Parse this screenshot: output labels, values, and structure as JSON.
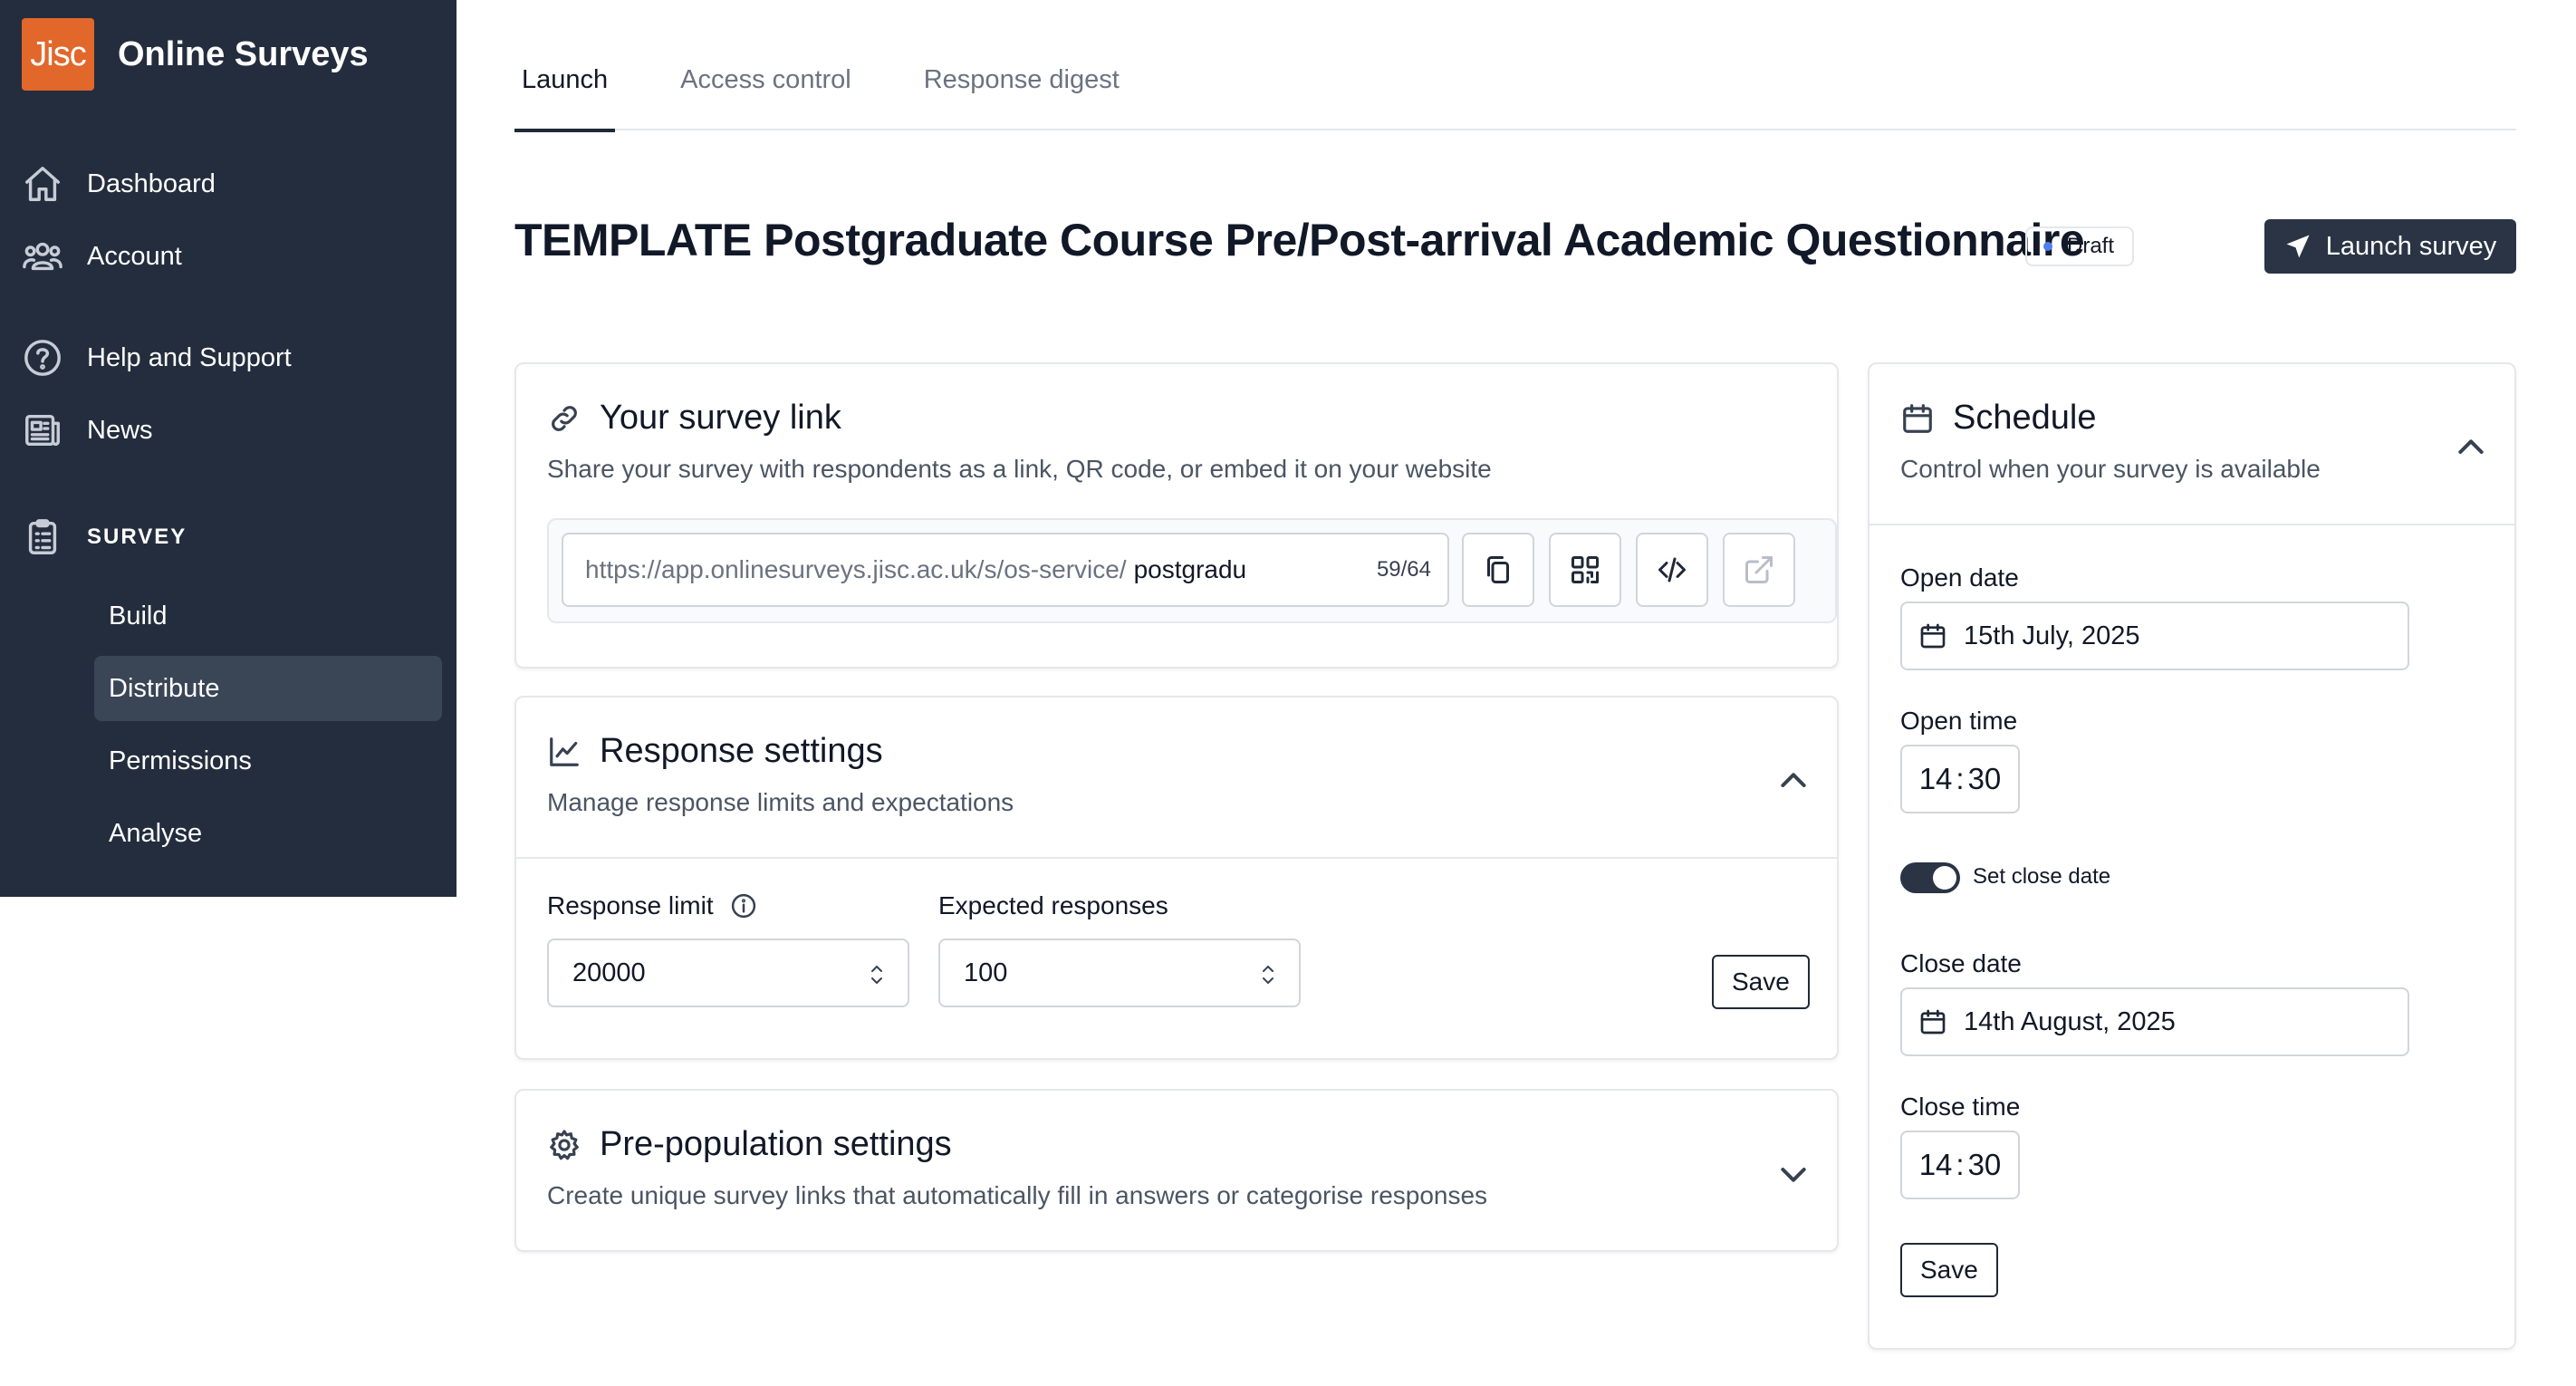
{
  "brand": {
    "logo_text": "Jisc",
    "app_name": "Online Surveys",
    "logo_color": "#e2672a"
  },
  "sidebar": {
    "nav": [
      {
        "label": "Dashboard",
        "icon": "home-icon"
      },
      {
        "label": "Account",
        "icon": "users-icon"
      },
      {
        "label": "Help and Support",
        "icon": "help-circle-icon"
      },
      {
        "label": "News",
        "icon": "newspaper-icon"
      }
    ],
    "section_label": "SURVEY",
    "survey_items": [
      {
        "label": "Build"
      },
      {
        "label": "Distribute",
        "active": true
      },
      {
        "label": "Permissions"
      },
      {
        "label": "Analyse"
      }
    ]
  },
  "tabs": [
    {
      "label": "Launch",
      "active": true
    },
    {
      "label": "Access control"
    },
    {
      "label": "Response digest"
    }
  ],
  "page": {
    "title": "TEMPLATE Postgraduate Course Pre/Post-arrival Academic Questionnaire",
    "status_badge": "Draft",
    "launch_label": "Launch survey"
  },
  "survey_link": {
    "title": "Your survey link",
    "subtitle": "Share your survey with respondents as a link, QR code, or embed it on your website",
    "url_prefix": "https://app.onlinesurveys.jisc.ac.uk/s/os-service/",
    "url_slug": "postgradu",
    "char_count": "59/64",
    "actions": [
      "copy-icon",
      "qr-code-icon",
      "code-icon",
      "external-link-icon"
    ]
  },
  "response_settings": {
    "title": "Response settings",
    "subtitle": "Manage response limits and expectations",
    "limit_label": "Response limit",
    "limit_value": "20000",
    "expected_label": "Expected responses",
    "expected_value": "100",
    "save_label": "Save"
  },
  "prepopulation": {
    "title": "Pre-population settings",
    "subtitle": "Create unique survey links that automatically fill in answers or categorise responses"
  },
  "schedule": {
    "title": "Schedule",
    "subtitle": "Control when your survey is available",
    "open_date_label": "Open date",
    "open_date": "15th July, 2025",
    "open_time_label": "Open time",
    "open_hour": "14",
    "open_minute": "30",
    "close_toggle_label": "Set close date",
    "close_toggle_on": true,
    "close_date_label": "Close date",
    "close_date": "14th August, 2025",
    "close_time_label": "Close time",
    "close_hour": "14",
    "close_minute": "30",
    "time_separator": ":",
    "save_label": "Save"
  }
}
